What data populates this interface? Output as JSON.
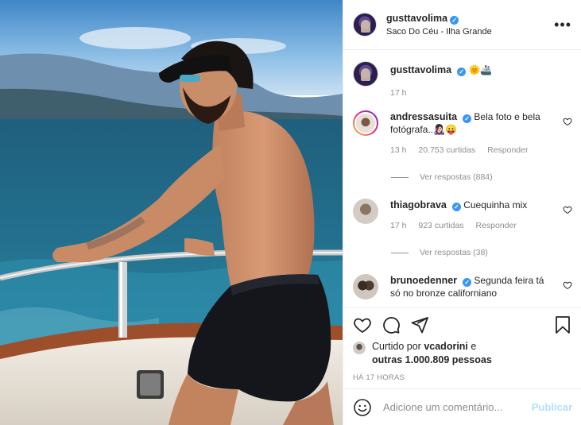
{
  "post": {
    "author": "gusttavolima",
    "location": "Saco Do Céu - Ilha Grande",
    "more_icon": "more-horizontal-icon"
  },
  "caption": {
    "username": "gusttavolima",
    "text": "🌞🚢",
    "time": "17 h"
  },
  "comments": [
    {
      "username": "andressasuita",
      "text": "Bela foto e bela fotógrafa..👩🏻‍🎤😛",
      "time": "13 h",
      "likes": "20.753 curtidas",
      "reply": "Responder",
      "view_replies": "Ver respostas (884)"
    },
    {
      "username": "thiagobrava",
      "text": "Cuequinha mix",
      "time": "17 h",
      "likes": "923 curtidas",
      "reply": "Responder",
      "view_replies": "Ver respostas (38)"
    },
    {
      "username": "brunoedenner",
      "text": "Segunda feira tá só no bronze californiano"
    }
  ],
  "actions": {
    "liked_prefix": "Curtido por",
    "liked_user": "vcadorini",
    "liked_and": "e",
    "liked_others": "outras 1.000.809 pessoas",
    "timestamp": "HÁ 17 HORAS"
  },
  "comment_box": {
    "placeholder": "Adicione um comentário...",
    "publish_label": "Publicar"
  },
  "colors": {
    "verified": "#3897f0",
    "publish": "#b2dffc",
    "muted_text": "#8e8e8e"
  }
}
